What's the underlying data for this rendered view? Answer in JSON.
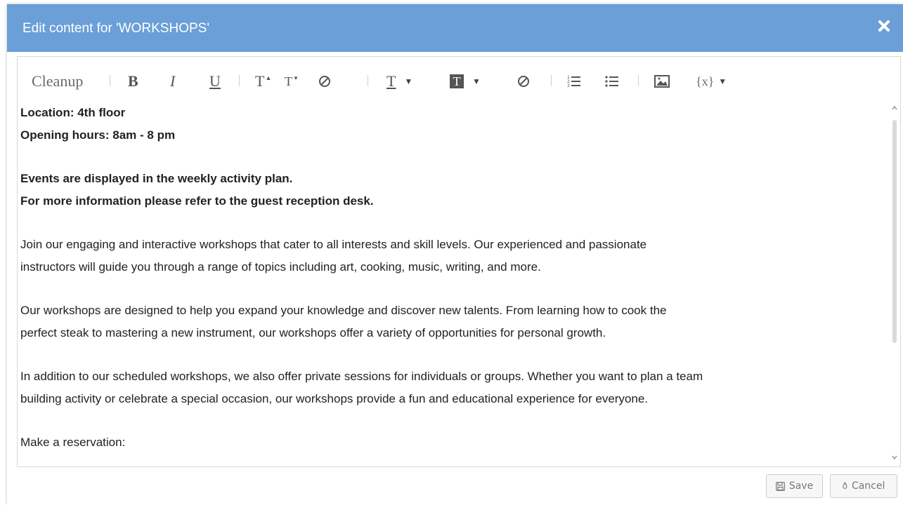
{
  "dialog": {
    "title": "Edit content for 'WORKSHOPS'",
    "header_color": "#6a9fd8",
    "close_icon": "close-icon"
  },
  "toolbar": {
    "cleanup_label": "Cleanup",
    "bold_label": "B",
    "italic_label": "I",
    "underline_label": "U",
    "font_size_up_label": "T",
    "font_size_down_label": "T",
    "clear_format_icon": "block-icon",
    "text_color_label": "T",
    "highlight_label": "T",
    "remove_color_icon": "block-icon",
    "ordered_list_icon": "ordered-list-icon",
    "unordered_list_icon": "unordered-list-icon",
    "image_icon": "image-icon",
    "variable_label": "{x}"
  },
  "content": {
    "bold_lines": [
      "Location: 4th floor",
      "Opening hours: 8am - 8 pm"
    ],
    "bold_lines_2": [
      "Events are displayed in the weekly activity plan.",
      "For more information please refer to the guest reception desk."
    ],
    "para1": [
      "Join our engaging and interactive workshops that cater to all interests and skill levels. Our experienced and passionate",
      "instructors will guide you through a range of topics including art, cooking, music, writing, and more."
    ],
    "para2": [
      "Our workshops are designed to help you expand your knowledge and discover new talents. From learning how to cook the",
      "perfect steak to mastering a new instrument, our workshops offer a variety of opportunities for personal growth."
    ],
    "para3": [
      "In addition to our scheduled workshops, we also offer private sessions for individuals or groups. Whether you want to plan a team",
      "building activity or celebrate a special occasion, our workshops provide a fun and educational experience for everyone."
    ],
    "reservation": "Make a reservation:"
  },
  "footer": {
    "save_label": "Save",
    "save_icon": "floppy-icon",
    "cancel_label": "Cancel",
    "cancel_icon": "cancel-icon"
  }
}
